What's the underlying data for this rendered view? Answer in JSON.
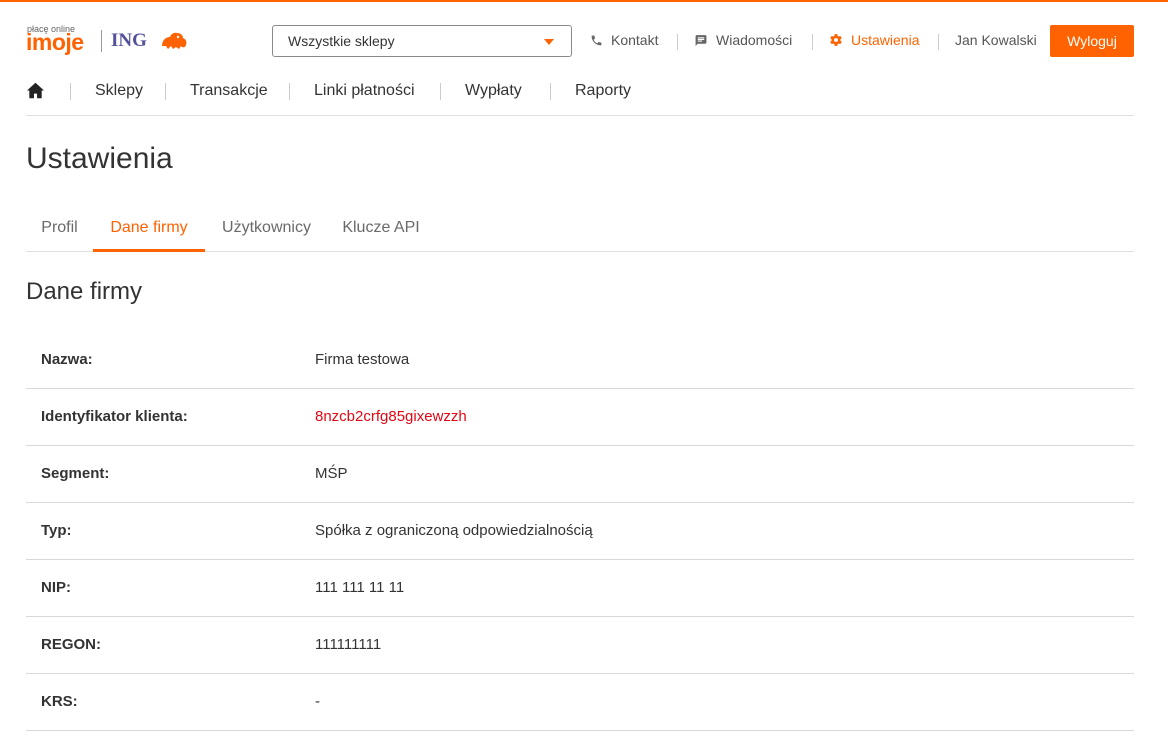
{
  "colors": {
    "accent": "#ff6200",
    "ing_blue": "#525199",
    "client_id_red": "#e30613",
    "text": "#333333"
  },
  "logo": {
    "tagline": "płacę online",
    "brand": "imoje",
    "partner": "ING"
  },
  "store_select": {
    "value": "Wszystkie sklepy",
    "icon": "chevron-down-icon"
  },
  "top_nav": {
    "contact": {
      "label": "Kontakt",
      "icon": "phone-icon"
    },
    "messages": {
      "label": "Wiadomości",
      "icon": "message-icon"
    },
    "settings": {
      "label": "Ustawienia",
      "icon": "gear-icon"
    },
    "user": "Jan Kowalski",
    "logout": "Wyloguj"
  },
  "main_nav": {
    "home_icon": "home-icon",
    "items": [
      "Sklepy",
      "Transakcje",
      "Linki płatności",
      "Wypłaty",
      "Raporty"
    ]
  },
  "page": {
    "title": "Ustawienia"
  },
  "tabs": {
    "items": [
      "Profil",
      "Dane firmy",
      "Użytkownicy",
      "Klucze API"
    ],
    "active": "Dane firmy"
  },
  "section": {
    "title": "Dane firmy"
  },
  "details": [
    {
      "label": "Nazwa:",
      "value": "Firma testowa"
    },
    {
      "label": "Identyfikator klienta:",
      "value": "8nzcb2crfg85gixewzzh"
    },
    {
      "label": "Segment:",
      "value": "MŚP"
    },
    {
      "label": "Typ:",
      "value": "Spółka z ograniczoną odpowiedzialnością"
    },
    {
      "label": "NIP:",
      "value": "111 111 11 11"
    },
    {
      "label": "REGON:",
      "value": "111111111"
    },
    {
      "label": "KRS:",
      "value": "-"
    }
  ]
}
